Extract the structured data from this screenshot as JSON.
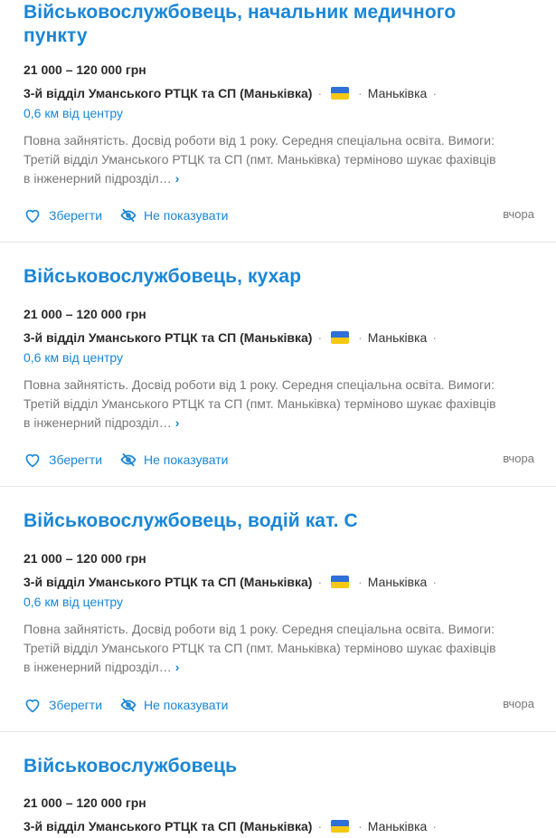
{
  "vacancies": [
    {
      "title": "Військовослужбовець, начальник медичного пункту",
      "salary": "21 000 – 120 000 грн",
      "company": "3-й відділ Уманського РТЦК та СП (Маньківка)",
      "city": "Маньківка",
      "distance": "0,6 км від центру",
      "description": "Повна зайнятість. Досвід роботи від 1 року. Середня спеціальна освіта. Вимоги: Третій відділ Уманського РТЦК та СП (пмт. Маньківка) терміново шукає фахівців в інженерний підрозділ…",
      "more": "›",
      "save_label": "Зберегти",
      "hide_label": "Не показувати",
      "date": "вчора"
    },
    {
      "title": "Військовослужбовець, кухар",
      "salary": "21 000 – 120 000 грн",
      "company": "3-й відділ Уманського РТЦК та СП (Маньківка)",
      "city": "Маньківка",
      "distance": "0,6 км від центру",
      "description": "Повна зайнятість. Досвід роботи від 1 року. Середня спеціальна освіта. Вимоги: Третій відділ Уманського РТЦК та СП (пмт. Маньківка) терміново шукає фахівців в інженерний підрозділ…",
      "more": "›",
      "save_label": "Зберегти",
      "hide_label": "Не показувати",
      "date": "вчора"
    },
    {
      "title": "Військовослужбовець, водій кат. С",
      "salary": "21 000 – 120 000 грн",
      "company": "3-й відділ Уманського РТЦК та СП (Маньківка)",
      "city": "Маньківка",
      "distance": "0,6 км від центру",
      "description": "Повна зайнятість. Досвід роботи від 1 року. Середня спеціальна освіта. Вимоги: Третій відділ Уманського РТЦК та СП (пмт. Маньківка) терміново шукає фахівців в інженерний підрозділ…",
      "more": "›",
      "save_label": "Зберегти",
      "hide_label": "Не показувати",
      "date": "вчора"
    },
    {
      "title": "Військовослужбовець",
      "salary": "21 000 – 120 000 грн",
      "company": "3-й відділ Уманського РТЦК та СП (Маньківка)",
      "city": "Маньківка"
    }
  ],
  "colors": {
    "link": "#1a86d6",
    "muted": "#777777",
    "flag_blue": "#2f6fd8",
    "flag_yellow": "#f5c813"
  },
  "icons": {
    "save": "heart-icon",
    "hide": "eye-off-icon",
    "flag": "ukraine-flag-icon"
  }
}
